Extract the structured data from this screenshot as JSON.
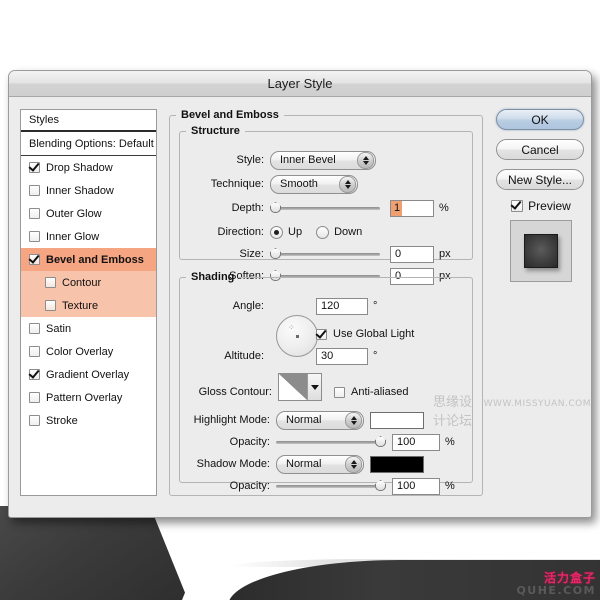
{
  "window": {
    "title": "Layer Style"
  },
  "styles_panel": {
    "header": "Styles",
    "blending_options": "Blending Options: Default",
    "items": [
      {
        "label": "Drop Shadow",
        "checked": true,
        "selected": false,
        "sub": false
      },
      {
        "label": "Inner Shadow",
        "checked": false,
        "selected": false,
        "sub": false
      },
      {
        "label": "Outer Glow",
        "checked": false,
        "selected": false,
        "sub": false
      },
      {
        "label": "Inner Glow",
        "checked": false,
        "selected": false,
        "sub": false
      },
      {
        "label": "Bevel and Emboss",
        "checked": true,
        "selected": true,
        "sub": false
      },
      {
        "label": "Contour",
        "checked": false,
        "selected": false,
        "sub": true
      },
      {
        "label": "Texture",
        "checked": false,
        "selected": false,
        "sub": true
      },
      {
        "label": "Satin",
        "checked": false,
        "selected": false,
        "sub": false
      },
      {
        "label": "Color Overlay",
        "checked": false,
        "selected": false,
        "sub": false
      },
      {
        "label": "Gradient Overlay",
        "checked": true,
        "selected": false,
        "sub": false
      },
      {
        "label": "Pattern Overlay",
        "checked": false,
        "selected": false,
        "sub": false
      },
      {
        "label": "Stroke",
        "checked": false,
        "selected": false,
        "sub": false
      }
    ]
  },
  "main": {
    "group_title": "Bevel and Emboss",
    "structure": {
      "title": "Structure",
      "style_label": "Style:",
      "style_value": "Inner Bevel",
      "technique_label": "Technique:",
      "technique_value": "Smooth",
      "depth_label": "Depth:",
      "depth_value": "1",
      "depth_unit": "%",
      "direction_label": "Direction:",
      "direction_up": "Up",
      "direction_down": "Down",
      "direction_selected": "Up",
      "size_label": "Size:",
      "size_value": "0",
      "size_unit": "px",
      "soften_label": "Soften:",
      "soften_value": "0",
      "soften_unit": "px"
    },
    "shading": {
      "title": "Shading",
      "angle_label": "Angle:",
      "angle_value": "120",
      "angle_unit": "°",
      "use_global_light_label": "Use Global Light",
      "use_global_light_checked": true,
      "altitude_label": "Altitude:",
      "altitude_value": "30",
      "altitude_unit": "°",
      "gloss_contour_label": "Gloss Contour:",
      "anti_aliased_label": "Anti-aliased",
      "anti_aliased_checked": false,
      "highlight_mode_label": "Highlight Mode:",
      "highlight_mode_value": "Normal",
      "highlight_color": "#ffffff",
      "highlight_opacity_label": "Opacity:",
      "highlight_opacity_value": "100",
      "highlight_opacity_unit": "%",
      "shadow_mode_label": "Shadow Mode:",
      "shadow_mode_value": "Normal",
      "shadow_color": "#000000",
      "shadow_opacity_label": "Opacity:",
      "shadow_opacity_value": "100",
      "shadow_opacity_unit": "%"
    }
  },
  "buttons": {
    "ok": "OK",
    "cancel": "Cancel",
    "new_style": "New Style...",
    "preview_label": "Preview",
    "preview_checked": true
  },
  "watermarks": {
    "forum_cn": "思缘设计论坛",
    "forum_url": "WWW.MISSYUAN.COM",
    "badge_cn": "活力盒子",
    "badge_url": "QUHE.COM"
  },
  "colors": {
    "selection_highlight": "#f5a582",
    "sub_selection_highlight": "#f7c3ab",
    "field_selection": "#f0a070",
    "dialog_bg": "#ececec"
  }
}
